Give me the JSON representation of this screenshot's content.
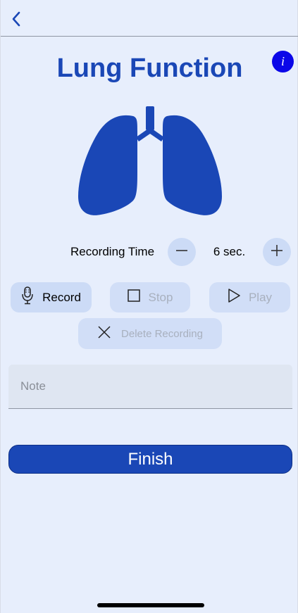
{
  "nav": {
    "back_icon": "chevron-left-icon"
  },
  "header": {
    "title": "Lung Function",
    "info_label": "i"
  },
  "illustration": {
    "icon": "lungs-icon"
  },
  "recording_time": {
    "label": "Recording Time",
    "value": "6 sec.",
    "decrement_icon": "minus-icon",
    "increment_icon": "plus-icon"
  },
  "actions": {
    "record_label": "Record",
    "record_icon": "microphone-icon",
    "stop_label": "Stop",
    "stop_icon": "stop-square-icon",
    "play_label": "Play",
    "play_icon": "play-triangle-icon",
    "delete_label": "Delete Recording",
    "delete_icon": "close-x-icon"
  },
  "note": {
    "placeholder": "Note",
    "value": ""
  },
  "finish": {
    "label": "Finish"
  },
  "colors": {
    "background": "#e7eefc",
    "accent": "#1a47b6",
    "info": "#0b07e8",
    "button_bg": "#ccdbf6",
    "disabled_text": "#a8b0be"
  }
}
